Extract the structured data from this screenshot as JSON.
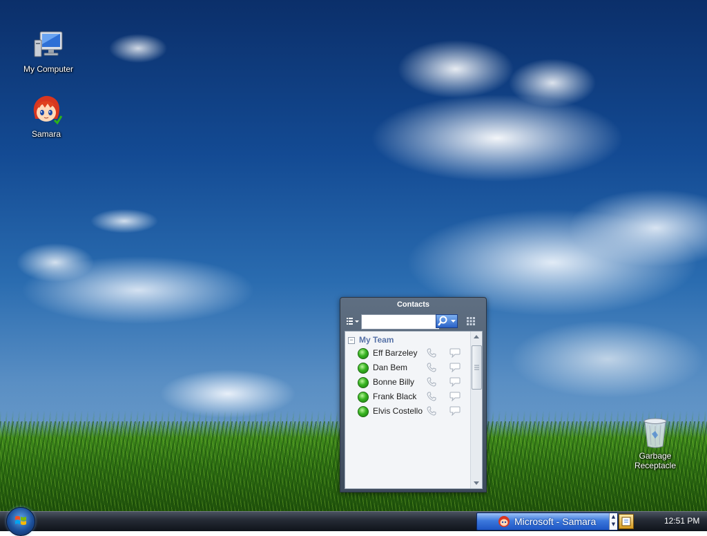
{
  "desktop": {
    "icons": [
      {
        "label": "My Computer",
        "icon": "computer-icon"
      },
      {
        "label": "Samara",
        "icon": "samara-avatar-icon"
      },
      {
        "label": "Garbage Receptacle",
        "icon": "trash-can-icon"
      }
    ]
  },
  "contacts_window": {
    "title": "Contacts",
    "search": {
      "value": "",
      "placeholder": ""
    },
    "group": {
      "name": "My Team",
      "expander": "−"
    },
    "contacts": [
      {
        "name": "Eff Barzeley",
        "status": "online"
      },
      {
        "name": "Dan Bem",
        "status": "online"
      },
      {
        "name": "Bonne Billy",
        "status": "online"
      },
      {
        "name": "Frank Black",
        "status": "online"
      },
      {
        "name": "Elvis Costello",
        "status": "online"
      }
    ]
  },
  "taskbar": {
    "task_button_label": "Microsoft - Samara",
    "clock": "12:51 PM"
  },
  "colors": {
    "online": "#36b320",
    "group_header": "#5873a8",
    "task_button": "#2a62c8"
  }
}
